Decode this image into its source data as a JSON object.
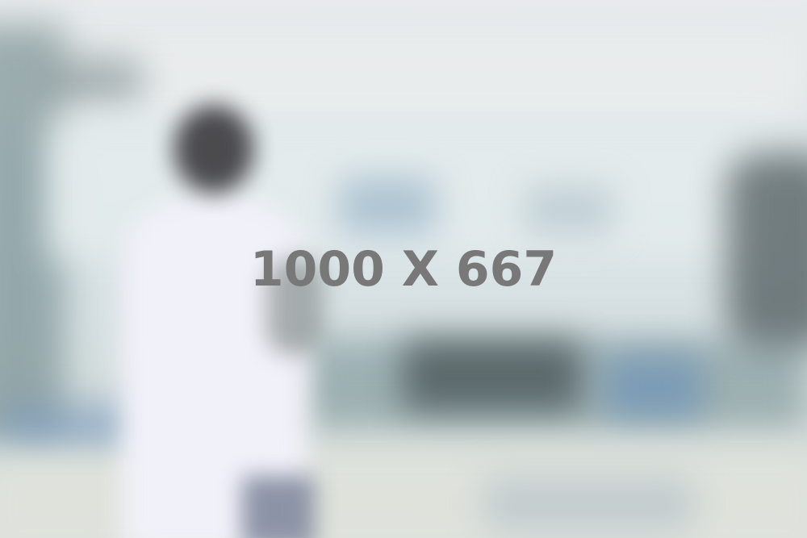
{
  "image": {
    "label": "1000 X 667",
    "label_color": "#787878",
    "background_palette": [
      "#e8ebec",
      "#d6e0e2",
      "#f1f1f9",
      "#3b3a3e",
      "#6d93b8"
    ]
  }
}
